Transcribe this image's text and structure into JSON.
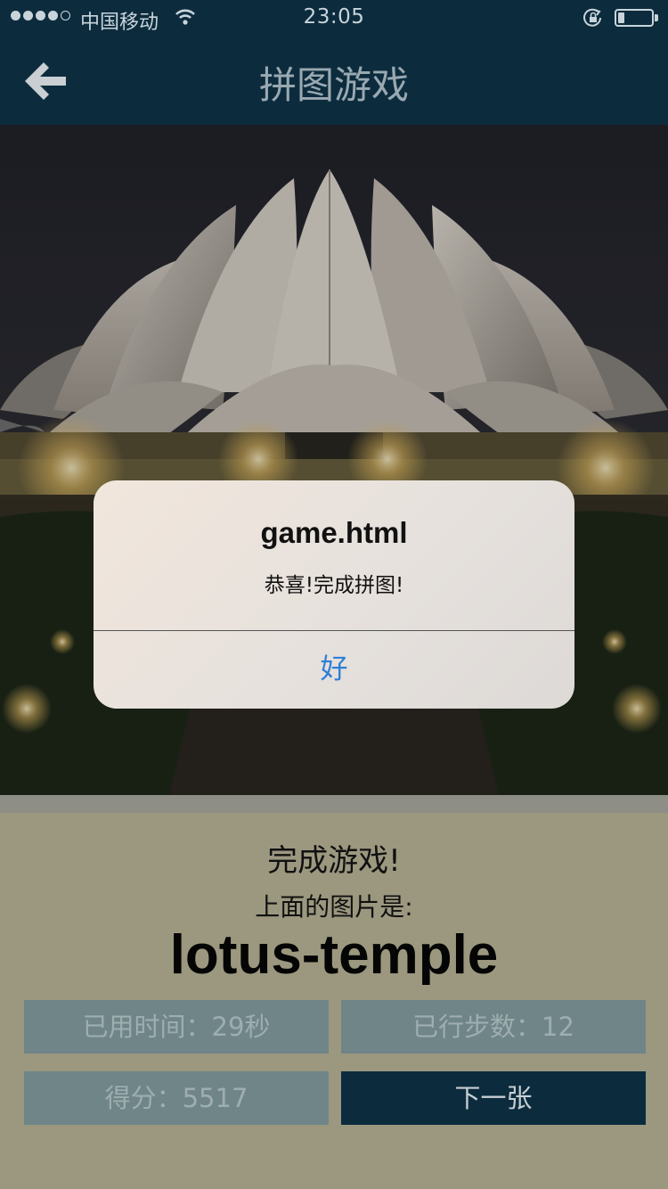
{
  "status_bar": {
    "carrier": "中国移动",
    "time": "23:05",
    "signal_filled": 4,
    "signal_total": 5,
    "battery_level": 0.2,
    "icons": [
      "wifi-icon",
      "rotation-lock-icon",
      "battery-icon"
    ]
  },
  "nav": {
    "title": "拼图游戏",
    "back_icon": "back-arrow-icon"
  },
  "alert": {
    "title": "game.html",
    "message": "恭喜!完成拼图!",
    "ok_label": "好"
  },
  "result": {
    "finish_text": "完成游戏!",
    "caption": "上面的图片是:",
    "answer": "lotus-temple"
  },
  "stats": {
    "time_label": "已用时间：29秒",
    "steps_label": "已行步数：12",
    "score_label": "得分：5517",
    "next_label": "下一张"
  },
  "colors": {
    "nav_bg": "#0c2c3e",
    "panel_bg": "#9b987f",
    "stat_bg": "#6f8588",
    "alert_button": "#2f7fd6"
  }
}
